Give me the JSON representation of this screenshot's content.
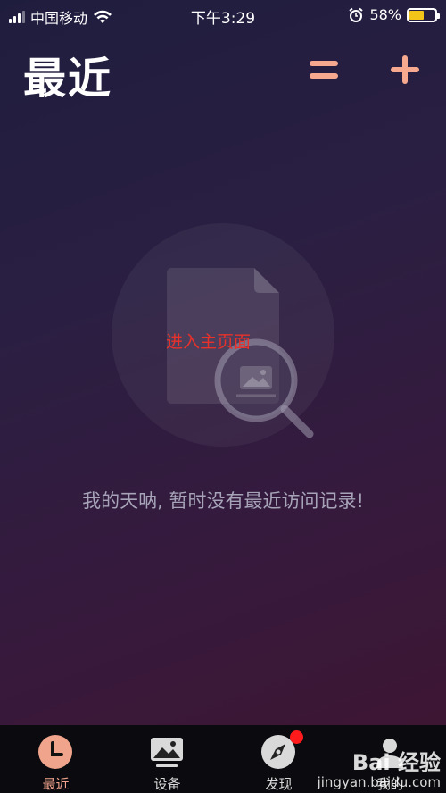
{
  "status_bar": {
    "carrier": "中国移动",
    "time": "下午3:29",
    "battery_percent": "58%",
    "battery_level": 0.58,
    "battery_color": "#f2c318"
  },
  "header": {
    "title": "最近",
    "menu_icon": "menu-icon",
    "add_icon": "plus-icon",
    "accent_color": "#f7a98f"
  },
  "empty_state": {
    "illustration_icon": "document-search-icon",
    "link_text": "进入主页面",
    "message": "我的天呐, 暂时没有最近访问记录!"
  },
  "tab_bar": {
    "tabs": [
      {
        "label": "最近",
        "icon": "clock-icon",
        "active": true
      },
      {
        "label": "设备",
        "icon": "device-icon",
        "active": false
      },
      {
        "label": "发现",
        "icon": "compass-icon",
        "active": false,
        "badge": true
      },
      {
        "label": "我的",
        "icon": "user-icon",
        "active": false
      }
    ],
    "active_color": "#f0a48c",
    "badge_color": "#ff1b1b"
  },
  "watermark": {
    "line1": "Bai 经验",
    "line2": "jingyan.baidu.com"
  }
}
